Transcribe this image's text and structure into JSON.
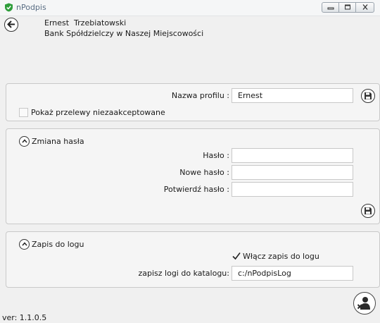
{
  "window": {
    "title": "nPodpis",
    "logo_icon": "shield-check-icon",
    "accent": "#2e9d3a",
    "controls": [
      "minimize-icon",
      "maximize-icon",
      "close-icon"
    ]
  },
  "header": {
    "back_icon": "arrow-left-icon",
    "user_name": "Ernest  Trzebiatowski",
    "bank_name": "Bank Spółdzielczy w Naszej Miejscowości"
  },
  "profile": {
    "name_label": "Nazwa profilu :",
    "name_value": "Ernest",
    "save_icon": "floppy-disk-icon",
    "show_unaccepted_label": "Pokaż przelewy niezaakceptowane",
    "show_unaccepted_checked": false
  },
  "password": {
    "section_title": "Zmiana hasła",
    "collapse_icon": "chevron-up-icon",
    "password_label": "Hasło :",
    "password_value": "",
    "new_password_label": "Nowe hasło :",
    "new_password_value": "",
    "confirm_password_label": "Potwierdź hasło :",
    "confirm_password_value": "",
    "save_icon": "floppy-disk-icon"
  },
  "log": {
    "section_title": "Zapis do logu",
    "collapse_icon": "chevron-up-icon",
    "enable_label": "Włącz zapis do logu",
    "enable_checked": true,
    "directory_label": "zapisz logi do katalogu:",
    "directory_value": "c:/nPodpisLog"
  },
  "footer": {
    "version": "ver: 1.1.0.5",
    "remove_user_icon": "user-remove-icon"
  }
}
